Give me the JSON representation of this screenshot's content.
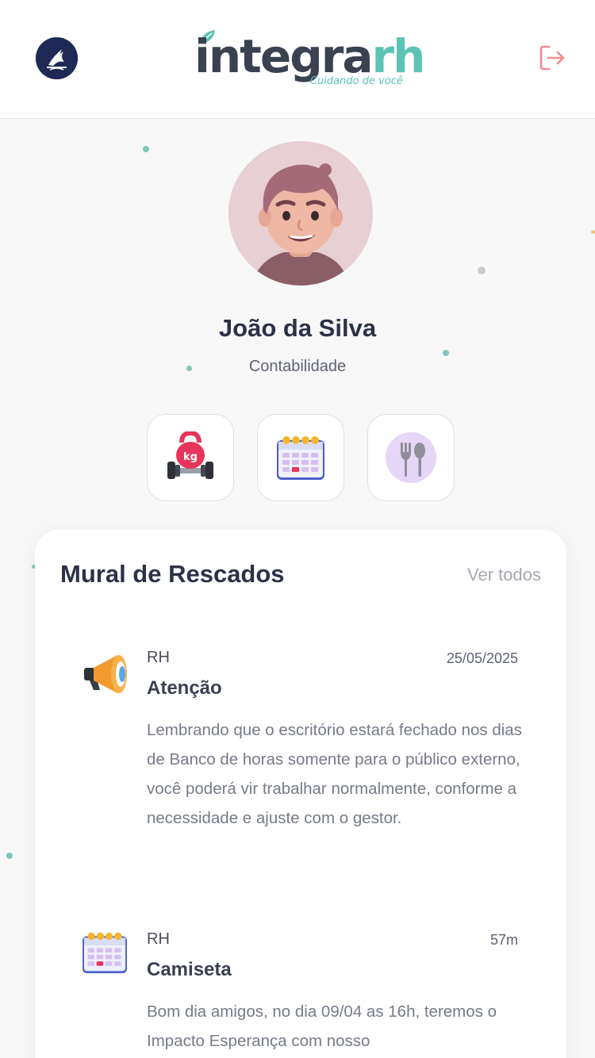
{
  "header": {
    "brand_main": "integra",
    "brand_accent": "rh",
    "brand_tagline": "Cuidando de você",
    "org_logo_icon": "church-flame-logo-icon",
    "logout_icon": "logout-icon"
  },
  "profile": {
    "name": "João da Silva",
    "department": "Contabilidade"
  },
  "quick_actions": [
    {
      "icon": "kettlebell-icon"
    },
    {
      "icon": "calendar-icon"
    },
    {
      "icon": "fork-spoon-icon"
    }
  ],
  "mural": {
    "title": "Mural de Rescados",
    "see_all": "Ver todos",
    "posts": [
      {
        "icon": "megaphone-icon",
        "sender": "RH",
        "time": "25/05/2025",
        "title": "Atenção",
        "body": "Lembrando que o escritório estará fechado nos dias de Banco de horas somente para o público externo, você poderá vir trabalhar normalmente, conforme a necessidade e ajuste com o gestor."
      },
      {
        "icon": "calendar-icon",
        "sender": "RH",
        "time": "57m",
        "title": "Camiseta",
        "body": "Bom dia amigos, no dia 09/04 as 16h, teremos o Impacto Esperança com nosso"
      }
    ]
  },
  "colors": {
    "brand_dark": "#3a4150",
    "brand_teal": "#5cc4b4",
    "navy": "#1e2a55",
    "logout_pink": "#f08c8c"
  }
}
